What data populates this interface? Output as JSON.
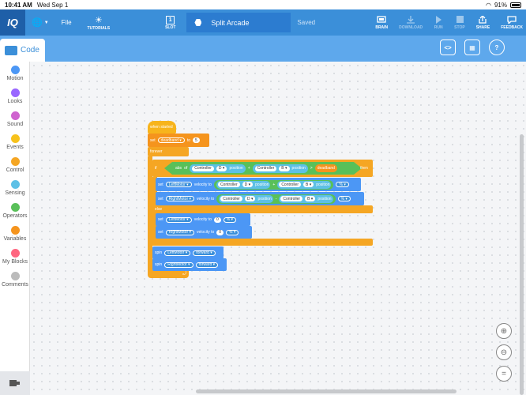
{
  "status_bar": {
    "time": "10:41 AM",
    "date": "Wed Sep 1",
    "battery": "91%"
  },
  "menu": {
    "logo": "IQ",
    "file_label": "File",
    "tutorials_label": "TUTORIALS",
    "slot_number": "1",
    "slot_label": "SLOT",
    "project_name": "Split Arcade",
    "save_status": "Saved",
    "brain_label": "BRAIN",
    "download_label": "DOWNLOAD",
    "run_label": "RUN",
    "stop_label": "STOP",
    "share_label": "SHARE",
    "feedback_label": "FEEDBACK"
  },
  "tabs": {
    "code_label": "Code"
  },
  "toolbar": {
    "code_view_icon": "code-brackets-icon",
    "device_icon": "device-icon",
    "help_label": "?"
  },
  "categories": [
    {
      "label": "Motion",
      "color": "#4c97f5"
    },
    {
      "label": "Looks",
      "color": "#9966ff"
    },
    {
      "label": "Sound",
      "color": "#cf63cf"
    },
    {
      "label": "Events",
      "color": "#f7c21c"
    },
    {
      "label": "Control",
      "color": "#f5a623"
    },
    {
      "label": "Sensing",
      "color": "#5dc0e6"
    },
    {
      "label": "Operators",
      "color": "#59c059"
    },
    {
      "label": "Variables",
      "color": "#f5941d"
    },
    {
      "label": "My Blocks",
      "color": "#ff6680"
    },
    {
      "label": "Comments",
      "color": "#bbbbbb"
    }
  ],
  "blocks": {
    "when_started": "when started",
    "set_label": "set",
    "deadband_var": "deadband",
    "to_label": "to",
    "deadband_value": "5",
    "forever": "forever",
    "if_label": "if",
    "then_label": "then",
    "abs_label": "abs",
    "of_label": "of",
    "controller": "Controller",
    "axis_d": "D",
    "axis_b": "B",
    "position": "position",
    "plus": "+",
    "minus": "-",
    "gt": ">",
    "else_label": "else",
    "left_motor": "LeftMotor",
    "right_motor": "RightMotor",
    "velocity_to": "velocity to",
    "percent": "%",
    "zero": "0",
    "spin_label": "spin",
    "forward": "forward"
  }
}
